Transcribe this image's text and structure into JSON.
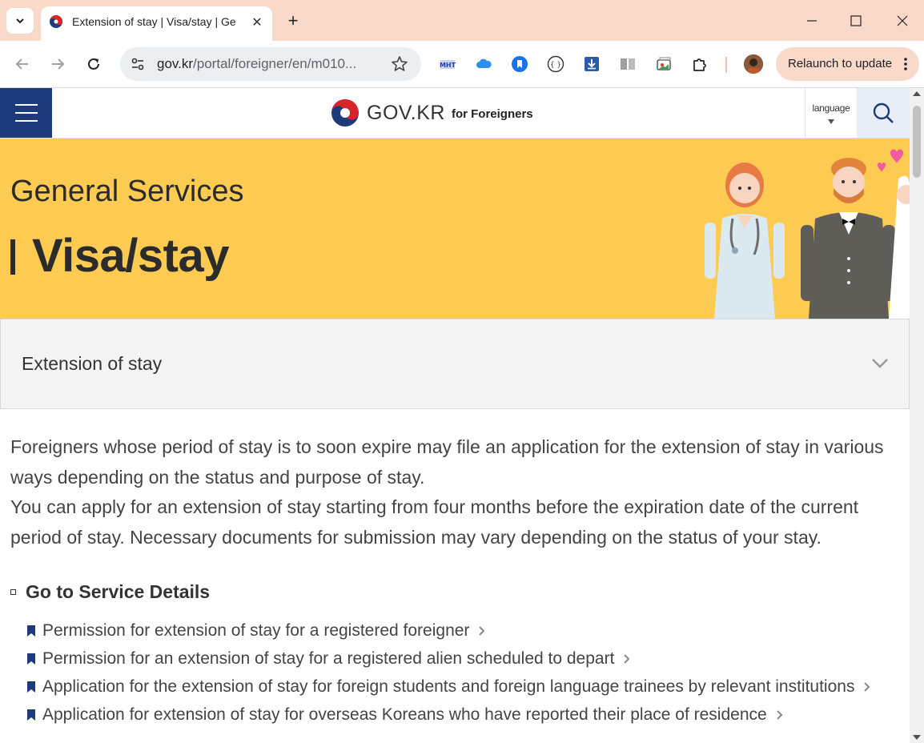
{
  "browser": {
    "tab": {
      "title": "Extension of stay | Visa/stay | Ge"
    },
    "address": {
      "host": "gov.kr",
      "path": "/portal/foreigner/en/m010..."
    },
    "relaunch_label": "Relaunch to update",
    "extensions": [
      "mht-icon",
      "cloud-icon",
      "bookmark-blue-icon",
      "bracket-icon",
      "download-icon",
      "reader-icon",
      "gallery-icon",
      "puzzle-icon"
    ]
  },
  "site": {
    "logo_text": "GOV.KR",
    "logo_sub": "for Foreigners",
    "language_label": "language"
  },
  "banner": {
    "subtitle": "General Services",
    "title": "Visa/stay"
  },
  "category_select": {
    "value": "Extension of stay"
  },
  "content": {
    "paragraph_1": "Foreigners whose period of stay is to soon expire may file an application for the extension of stay in various ways depending on the status and purpose of stay.",
    "paragraph_2": "You can apply for an extension of stay starting from four months before the expiration date of the current period of stay. Necessary documents for submission may vary depending on the status of your stay.",
    "section_title": "Go to Service Details",
    "links": [
      "Permission for extension of stay for a registered foreigner",
      "Permission for an extension of stay for a registered alien scheduled to depart",
      "Application for the extension of stay for foreign students and foreign language trainees by relevant institutions",
      "Application for extension of stay for overseas Koreans who have reported their place of residence"
    ]
  },
  "colors": {
    "banner": "#fecb52",
    "menu": "#1e3a7b",
    "tabbar": "#f9d9c9",
    "bullet": "#1e3a7b"
  }
}
